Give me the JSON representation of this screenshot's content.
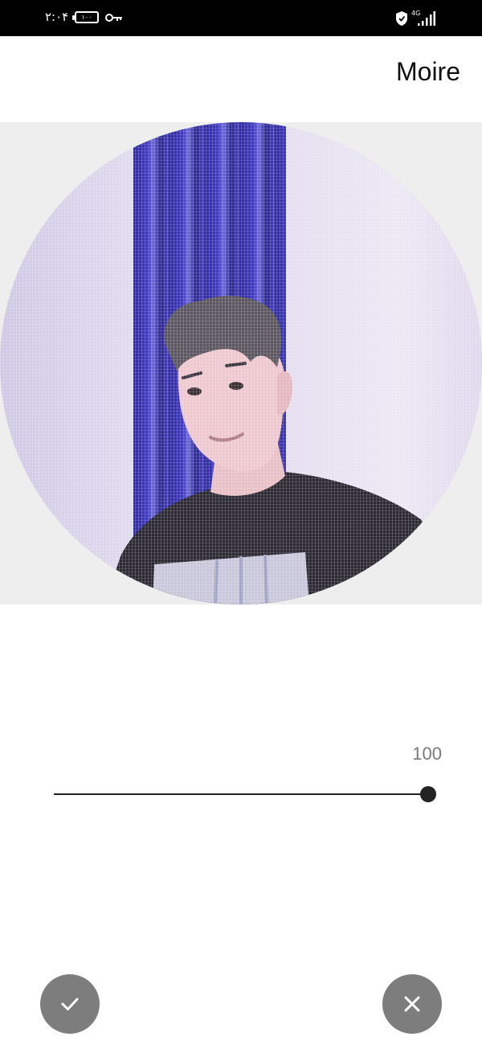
{
  "status_bar": {
    "time": "۲:۰۴",
    "battery": "۱۰۰",
    "network": "4G",
    "icons": [
      "battery-icon",
      "key-icon",
      "shield-icon",
      "signal-icon"
    ]
  },
  "header": {
    "title": "Moire"
  },
  "preview": {
    "subject": "circular-cropped-photo"
  },
  "slider": {
    "value_label": "100",
    "value": 100,
    "max": 100
  },
  "actions": {
    "confirm_icon": "check-icon",
    "cancel_icon": "close-icon"
  },
  "colors": {
    "fab": "#7d7d7d",
    "slider": "#222222",
    "status_bar": "#000000"
  }
}
